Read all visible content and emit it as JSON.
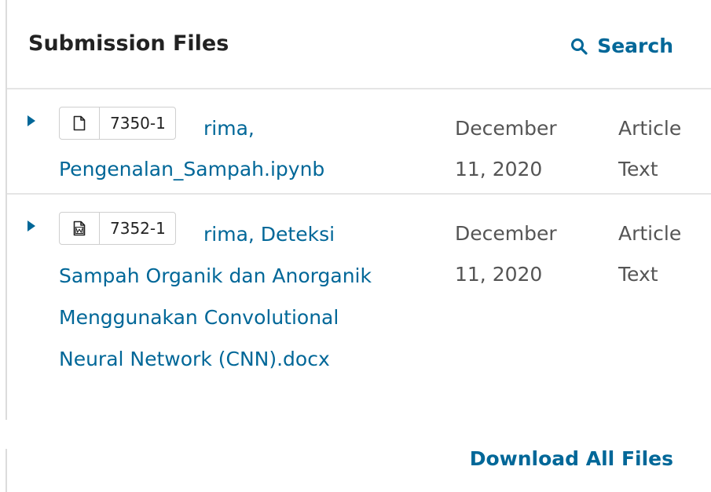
{
  "panel": {
    "title": "Submission Files",
    "search_label": "Search",
    "download_all_label": "Download All Files"
  },
  "files": [
    {
      "icon": "file-icon",
      "id": "7350-1",
      "name": "rima, Pengenalan_Sampah.ipynb",
      "date": "December 11, 2020",
      "genre": "Article Text"
    },
    {
      "icon": "word-doc-icon",
      "id": "7352-1",
      "name": "rima, Deteksi Sampah Organik dan Anorganik Menggunakan Convolutional Neural Network (CNN).docx",
      "date": "December 11, 2020",
      "genre": "Article Text"
    }
  ],
  "colors": {
    "link": "#006798",
    "muted_text": "#555555",
    "title_text": "#222222",
    "divider": "#e5e5e5"
  }
}
